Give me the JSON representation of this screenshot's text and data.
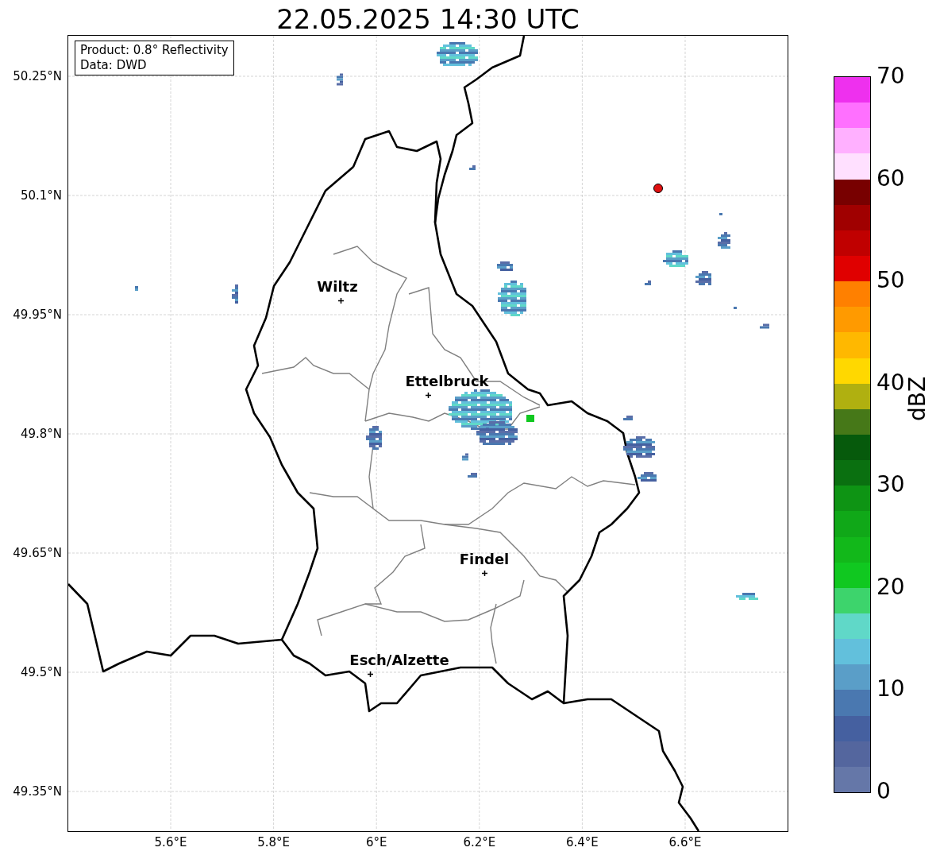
{
  "title": "22.05.2025 14:30 UTC",
  "map": {
    "info": [
      "Product: 0.8° Reflectivity",
      "Data: DWD"
    ],
    "y_ticks": [
      "50.25°N",
      "50.1°N",
      "49.95°N",
      "49.8°N",
      "49.65°N",
      "49.5°N",
      "49.35°N"
    ],
    "x_ticks": [
      "5.6°E",
      "5.8°E",
      "6°E",
      "6.2°E",
      "6.4°E",
      "6.6°E"
    ],
    "cities": [
      {
        "name": "Wiltz"
      },
      {
        "name": "Ettelbruck"
      },
      {
        "name": "Findel"
      },
      {
        "name": "Esch/Alzette"
      }
    ],
    "colorbar": {
      "label": "dBZ",
      "ticks": [
        "70",
        "60",
        "50",
        "40",
        "30",
        "20",
        "10",
        "0"
      ],
      "bins": [
        {
          "color": "#ee30ee"
        },
        {
          "color": "#ff70ff"
        },
        {
          "color": "#ffb0ff"
        },
        {
          "color": "#ffe0ff"
        },
        {
          "color": "#780000"
        },
        {
          "color": "#a00000"
        },
        {
          "color": "#c00000"
        },
        {
          "color": "#e00000"
        },
        {
          "color": "#ff8000"
        },
        {
          "color": "#ff9a00"
        },
        {
          "color": "#ffb800"
        },
        {
          "color": "#ffd800"
        },
        {
          "color": "#b0b010"
        },
        {
          "color": "#467818"
        },
        {
          "color": "#065a0c"
        },
        {
          "color": "#0a7010"
        },
        {
          "color": "#0e9414"
        },
        {
          "color": "#10a818"
        },
        {
          "color": "#12b81a"
        },
        {
          "color": "#10c820"
        },
        {
          "color": "#3dd46c"
        },
        {
          "color": "#60d8c8"
        },
        {
          "color": "#62c0dc"
        },
        {
          "color": "#5a9ec8"
        },
        {
          "color": "#4a78b0"
        },
        {
          "color": "#4560a0"
        },
        {
          "color": "#54669e"
        },
        {
          "color": "#6577a8"
        }
      ]
    }
  }
}
